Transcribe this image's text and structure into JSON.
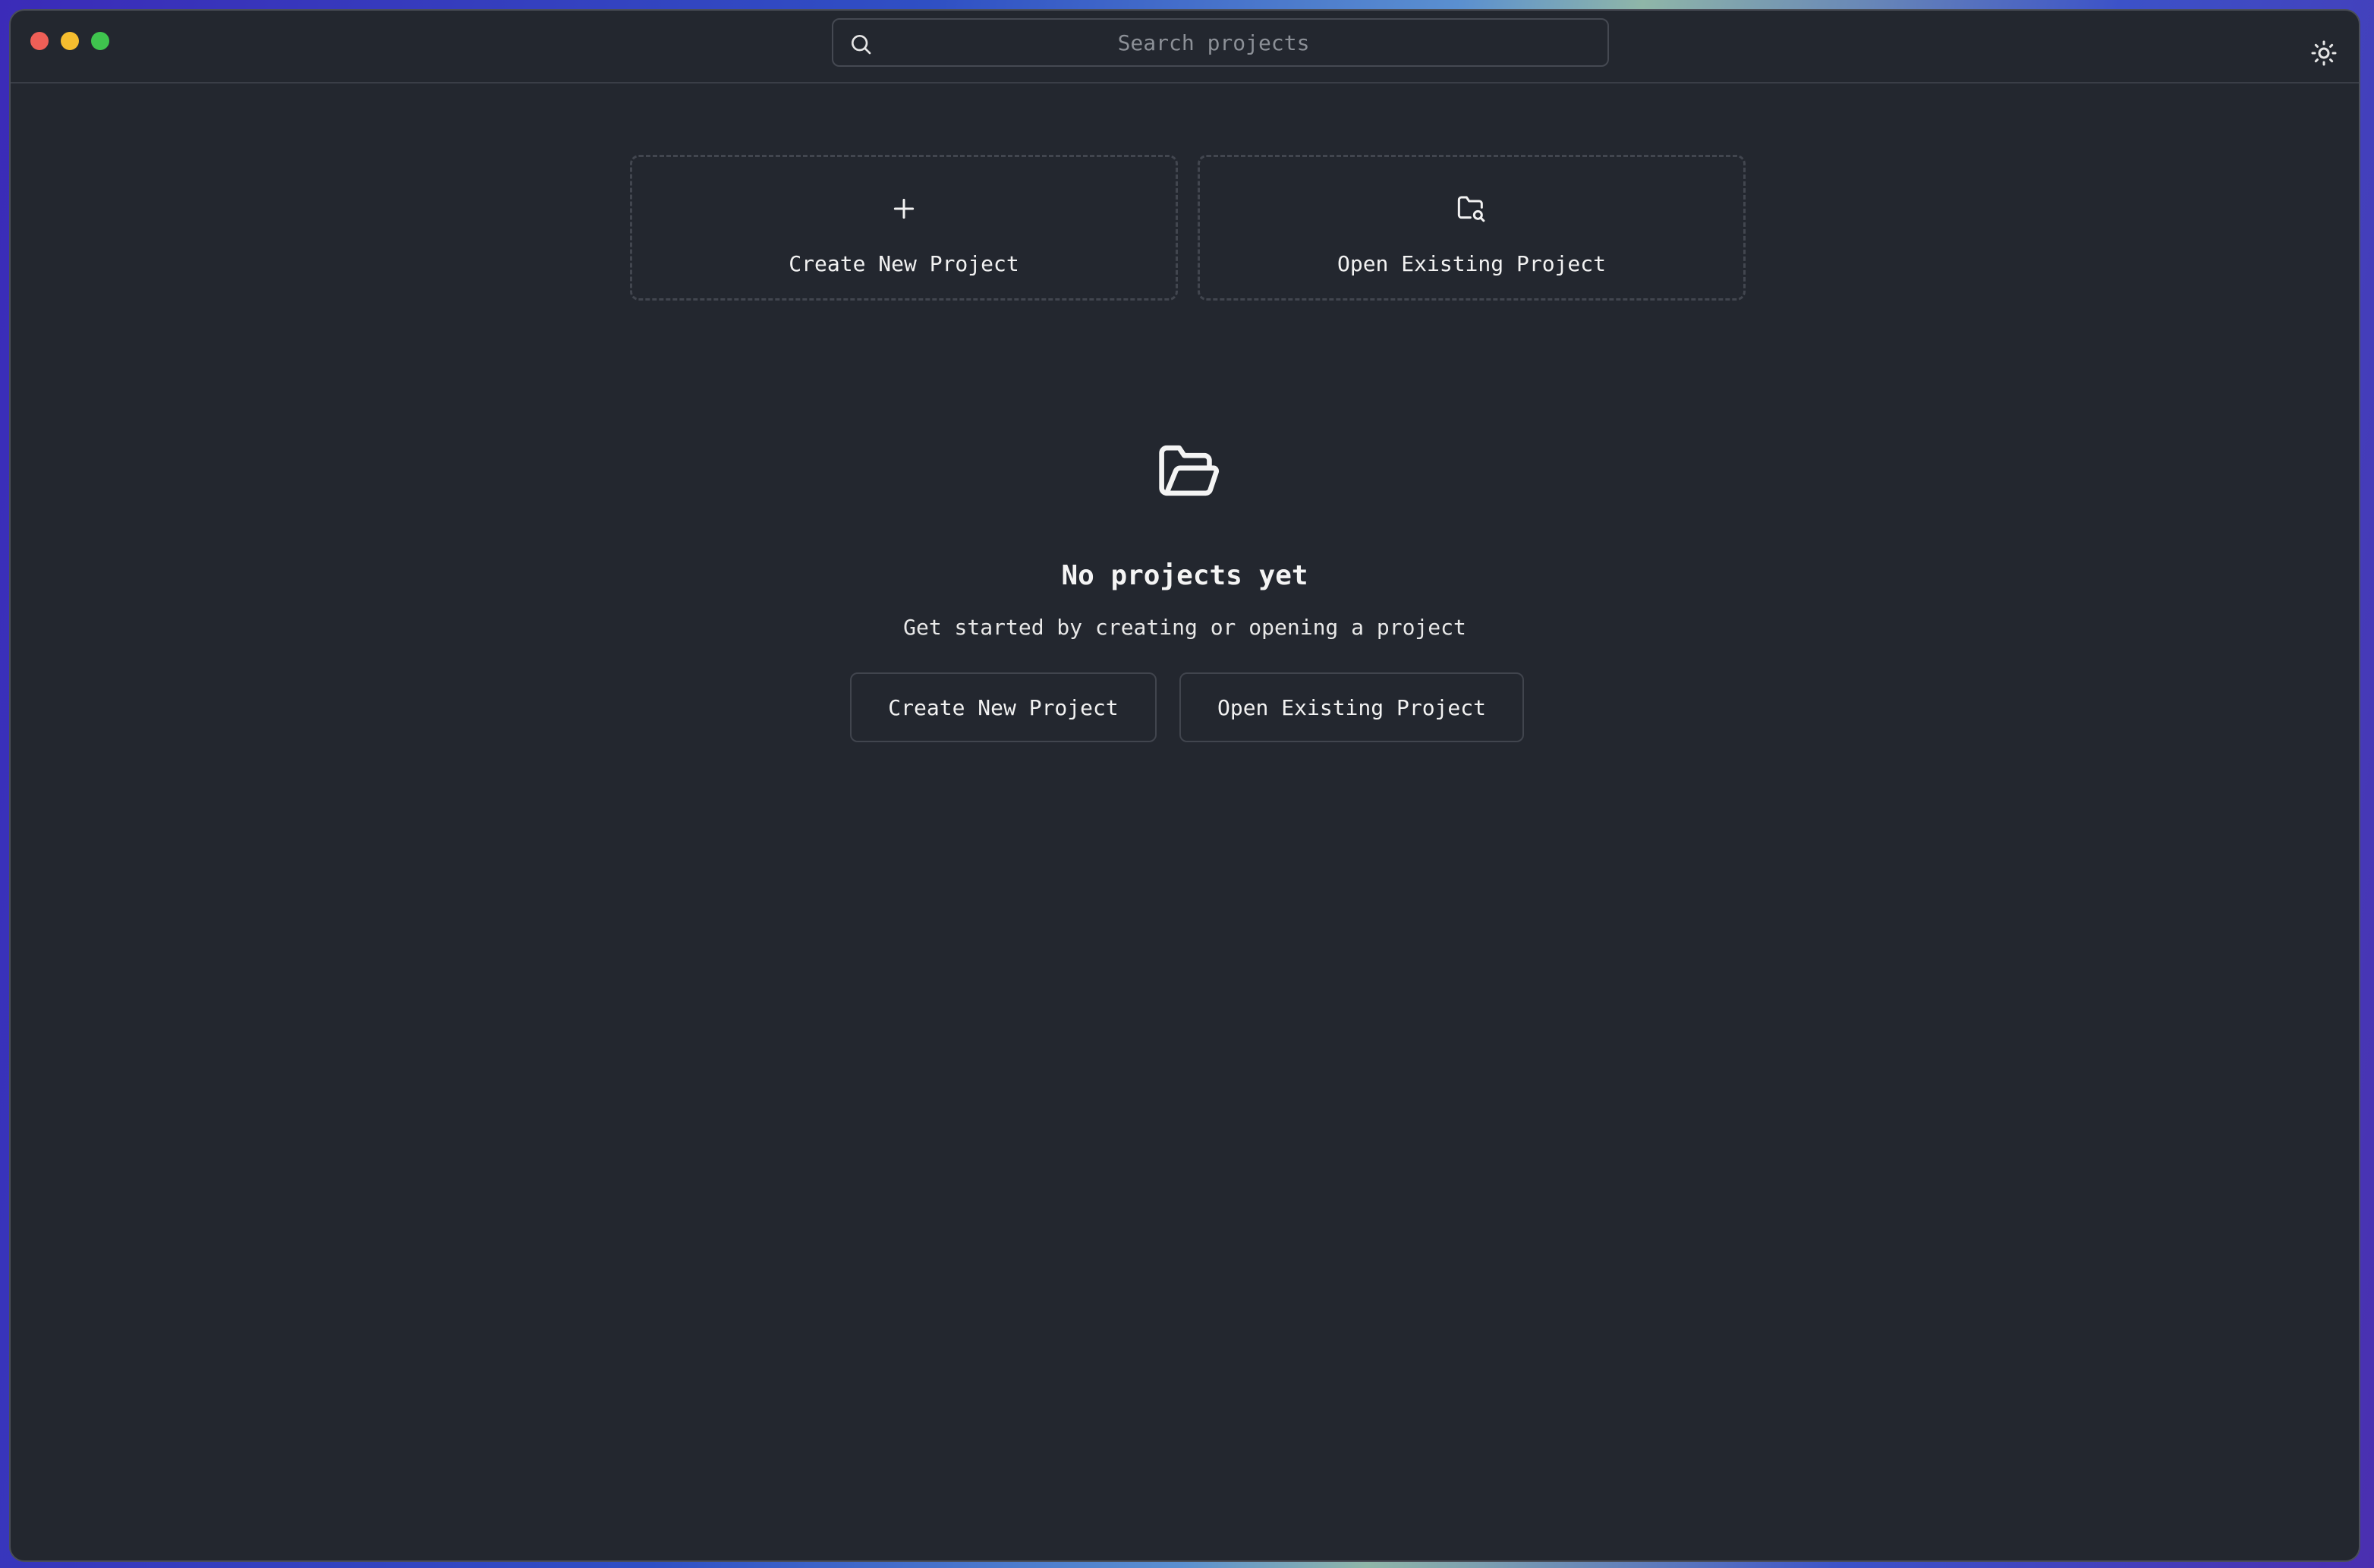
{
  "window_controls": {
    "close_color": "#ee5f57",
    "minimize_color": "#f5bd2f",
    "maximize_color": "#3fc44e"
  },
  "search": {
    "placeholder": "Search projects",
    "value": "",
    "icon": "search-icon"
  },
  "header": {
    "theme_toggle_icon": "sun-icon"
  },
  "cards": {
    "create": {
      "icon": "plus-icon",
      "label": "Create New Project"
    },
    "open": {
      "icon": "folder-search-icon",
      "label": "Open Existing Project"
    }
  },
  "empty_state": {
    "icon": "folder-open-icon",
    "title": "No projects yet",
    "subtitle": "Get started by creating or opening a project",
    "create_button": "Create New Project",
    "open_button": "Open Existing Project"
  },
  "colors": {
    "background": "#23272f",
    "text": "#f2f2f2",
    "border": "#41454e"
  }
}
